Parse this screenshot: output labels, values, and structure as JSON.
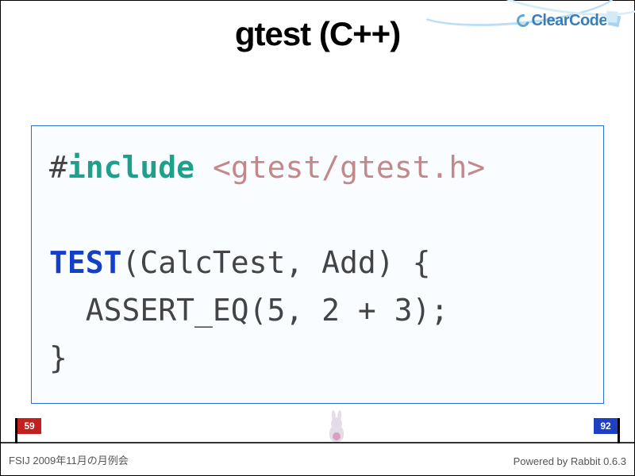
{
  "brand": {
    "name": "ClearCode"
  },
  "title": "gtest (C++)",
  "code": {
    "hash": "#",
    "include_kw": "include",
    "space1": " ",
    "header": "<gtest/gtest.h>",
    "blank": "",
    "test_macro": "TEST",
    "test_args": "(CalcTest, Add) {",
    "assert_line": "  ASSERT_EQ(5, 2 + 3);",
    "close": "}"
  },
  "progress": {
    "current": "59",
    "total": "92"
  },
  "footer": {
    "left": "FSIJ 2009年11月の月例会",
    "right": "Powered by Rabbit 0.6.3"
  }
}
